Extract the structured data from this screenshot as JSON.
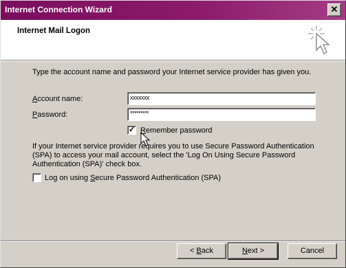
{
  "window": {
    "title": "Internet Connection Wizard",
    "close_label": "✕"
  },
  "header": {
    "title": "Internet Mail Logon"
  },
  "intro": "Type the account name and password your Internet service provider has given you.",
  "account": {
    "label_underline": "A",
    "label_rest": "ccount name:",
    "value": "xxxxxxx"
  },
  "password": {
    "label_underline": "P",
    "label_rest": "assword:",
    "value": "*********"
  },
  "remember": {
    "label_underline": "R",
    "label_rest": "emember password",
    "checked": true
  },
  "spa_paragraph": "If your Internet service provider requires you to use Secure Password Authentication (SPA) to access your mail account, select the 'Log On Using Secure Password Authentication (SPA)' check box.",
  "spa_checkbox": {
    "label_pre": "Log on using ",
    "label_underline": "S",
    "label_rest": "ecure Password Authentication (SPA)",
    "checked": false
  },
  "buttons": {
    "back_prefix": "< ",
    "back_underline": "B",
    "back_rest": "ack",
    "next_underline": "N",
    "next_rest": "ext >",
    "cancel": "Cancel"
  },
  "icons": {
    "wizard": "wizard-sparkle-cursor-icon",
    "cursor": "mouse-pointer-icon"
  },
  "colors": {
    "titlebar": "#7a0e5e",
    "face": "#d4d0c8"
  }
}
